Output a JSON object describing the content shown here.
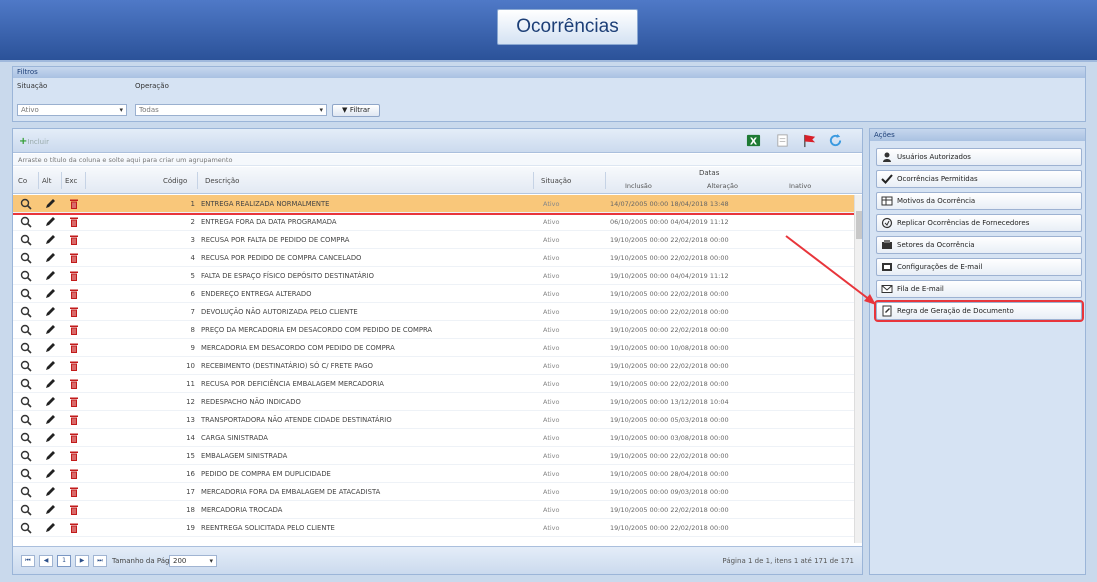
{
  "header": {
    "title": "Ocorrências"
  },
  "filters": {
    "title": "Filtros",
    "situacao_label": "Situação",
    "situacao_value": "Ativo",
    "operacao_label": "Operação",
    "operacao_value": "Todas",
    "filter_button": "Filtrar"
  },
  "grid": {
    "add_label": "Incluir",
    "group_hint": "Arraste o título da coluna e solte aqui para criar um agrupamento",
    "columns": {
      "con": "Co",
      "alt": "Alt",
      "exc": "Exc",
      "codigo": "Código",
      "descricao": "Descrição",
      "situacao": "Situação",
      "datas": "Datas",
      "inclusao": "Inclusão",
      "alteracao": "Alteração",
      "inativo": "Inativo"
    },
    "rows": [
      {
        "codigo": "1",
        "descricao": "Entrega realizada normalmente",
        "situacao": "Ativo",
        "datas": "14/07/2005 00:00  18/04/2018 13:48"
      },
      {
        "codigo": "2",
        "descricao": "Entrega fora da data programada",
        "situacao": "Ativo",
        "datas": "06/10/2005 00:00  04/04/2019 11:12"
      },
      {
        "codigo": "3",
        "descricao": "Recusa por falta de pedido de compra",
        "situacao": "Ativo",
        "datas": "19/10/2005 00:00  22/02/2018 00:00"
      },
      {
        "codigo": "4",
        "descricao": "Recusa por pedido de compra cancelado",
        "situacao": "Ativo",
        "datas": "19/10/2005 00:00  22/02/2018 00:00"
      },
      {
        "codigo": "5",
        "descricao": "Falta de espaço físico depósito destinatário",
        "situacao": "Ativo",
        "datas": "19/10/2005 00:00  04/04/2019 11:12"
      },
      {
        "codigo": "6",
        "descricao": "Endereço entrega alterado",
        "situacao": "Ativo",
        "datas": "19/10/2005 00:00  22/02/2018 00:00"
      },
      {
        "codigo": "7",
        "descricao": "Devolução não autorizada pelo cliente",
        "situacao": "Ativo",
        "datas": "19/10/2005 00:00  22/02/2018 00:00"
      },
      {
        "codigo": "8",
        "descricao": "Preço da mercadoria em desacordo com pedido de compra",
        "situacao": "Ativo",
        "datas": "19/10/2005 00:00  22/02/2018 00:00"
      },
      {
        "codigo": "9",
        "descricao": "Mercadoria em desacordo com pedido de compra",
        "situacao": "Ativo",
        "datas": "19/10/2005 00:00  10/08/2018 00:00"
      },
      {
        "codigo": "10",
        "descricao": "Recebimento (destinatário) só c/ frete pago",
        "situacao": "Ativo",
        "datas": "19/10/2005 00:00  22/02/2018 00:00"
      },
      {
        "codigo": "11",
        "descricao": "Recusa por deficiência embalagem mercadoria",
        "situacao": "Ativo",
        "datas": "19/10/2005 00:00  22/02/2018 00:00"
      },
      {
        "codigo": "12",
        "descricao": "Redespacho não indicado",
        "situacao": "Ativo",
        "datas": "19/10/2005 00:00  13/12/2018 10:04"
      },
      {
        "codigo": "13",
        "descricao": "Transportadora não atende cidade destinatário",
        "situacao": "Ativo",
        "datas": "19/10/2005 00:00  05/03/2018 00:00"
      },
      {
        "codigo": "14",
        "descricao": "Carga sinistrada",
        "situacao": "Ativo",
        "datas": "19/10/2005 00:00  03/08/2018 00:00"
      },
      {
        "codigo": "15",
        "descricao": "Embalagem sinistrada",
        "situacao": "Ativo",
        "datas": "19/10/2005 00:00  22/02/2018 00:00"
      },
      {
        "codigo": "16",
        "descricao": "Pedido de compra em duplicidade",
        "situacao": "Ativo",
        "datas": "19/10/2005 00:00  28/04/2018 00:00"
      },
      {
        "codigo": "17",
        "descricao": "Mercadoria fora da embalagem de atacadista",
        "situacao": "Ativo",
        "datas": "19/10/2005 00:00  09/03/2018 00:00"
      },
      {
        "codigo": "18",
        "descricao": "Mercadoria trocada",
        "situacao": "Ativo",
        "datas": "19/10/2005 00:00  22/02/2018 00:00"
      },
      {
        "codigo": "19",
        "descricao": "Reentrega solicitada pelo cliente",
        "situacao": "Ativo",
        "datas": "19/10/2005 00:00  22/02/2018 00:00"
      }
    ],
    "pager": {
      "page": "1",
      "size_label": "Tamanho da Página",
      "size_value": "200",
      "info": "Página 1 de 1, itens 1 até 171 de 171"
    }
  },
  "actions": {
    "title": "Ações",
    "items": [
      {
        "label": "Usuários Autorizados",
        "icon": "users-icon"
      },
      {
        "label": "Ocorrências Permitidas",
        "icon": "check-icon"
      },
      {
        "label": "Motivos da Ocorrência",
        "icon": "table-icon"
      },
      {
        "label": "Replicar Ocorrências de Fornecedores",
        "icon": "replicate-icon"
      },
      {
        "label": "Setores da Ocorrência",
        "icon": "sectors-icon"
      },
      {
        "label": "Configurações de E-mail",
        "icon": "email-config-icon"
      },
      {
        "label": "Fila de E-mail",
        "icon": "email-queue-icon"
      },
      {
        "label": "Regra de Geração de Documento",
        "icon": "document-rule-icon"
      }
    ]
  },
  "colors": {
    "highlight": "#e8353b",
    "selected_row": "#f9c77a",
    "header": "#2b5299"
  }
}
